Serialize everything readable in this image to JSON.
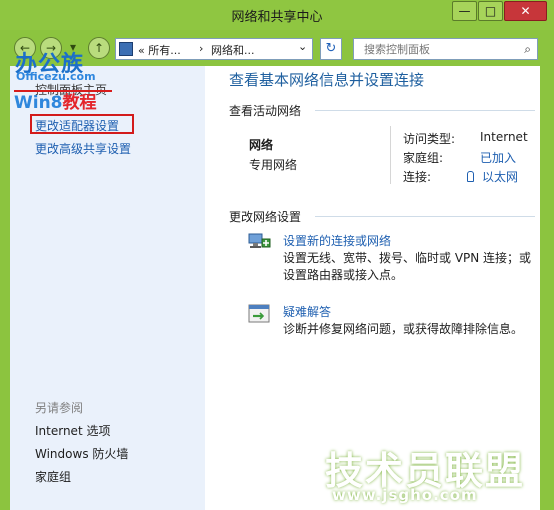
{
  "window": {
    "title": "网络和共享中心",
    "min_label": "—",
    "max_label": "□",
    "close_label": "✕"
  },
  "nav": {
    "back_label": "←",
    "forward_label": "→",
    "recent_label": "▾",
    "up_label": "↑",
    "address": {
      "seg1": "«  所有...",
      "sep": "›",
      "seg2": "网络和...",
      "dropdown": "⌄"
    },
    "refresh_label": "↻",
    "search_placeholder": "搜索控制面板",
    "search_icon": "⌕"
  },
  "watermark_logo": {
    "line1": "办公族",
    "line2": "Officezu.com",
    "line3_a": "Win8",
    "line3_b": "教程"
  },
  "sidebar": {
    "home": "控制面板主页",
    "links": [
      "更改适配器设置",
      "更改高级共享设置"
    ],
    "see_also_title": "另请参阅",
    "see_also": [
      "Internet 选项",
      "Windows 防火墙",
      "家庭组"
    ]
  },
  "main": {
    "title": "查看基本网络信息并设置连接",
    "active_title": "查看活动网络",
    "network": {
      "name": "网络",
      "type": "专用网络"
    },
    "props": [
      {
        "label": "访问类型:",
        "value": "Internet",
        "link": false
      },
      {
        "label": "家庭组:",
        "value": "已加入",
        "link": true
      },
      {
        "label": "连接:",
        "value": "以太网",
        "link": true
      }
    ],
    "change_title": "更改网络设置",
    "actions": [
      {
        "link": "设置新的连接或网络",
        "desc": "设置无线、宽带、拨号、临时或 VPN 连接；或设置路由器或接入点。",
        "icon": "network-setup-icon"
      },
      {
        "link": "疑难解答",
        "desc": "诊断并修复网络问题，或获得故障排除信息。",
        "icon": "troubleshoot-icon"
      }
    ]
  },
  "watermark_site": {
    "line1": "技术员联盟",
    "line2": "www.jsgho.com"
  },
  "colors": {
    "frame_green": "#8cc43f",
    "link_blue": "#1e5fb0",
    "title_blue": "#1e5f9f",
    "sidebar_bg": "#eaf1fb",
    "highlight_red": "#d31b1b"
  }
}
